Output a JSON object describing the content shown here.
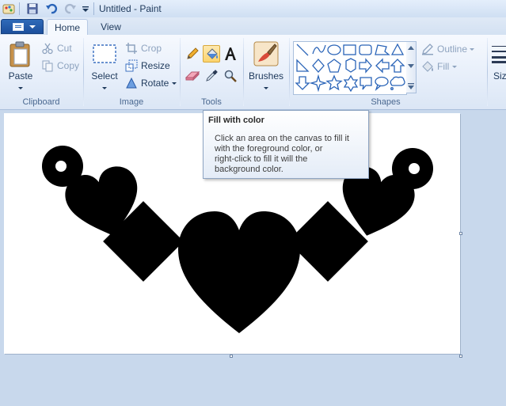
{
  "window": {
    "title": "Untitled - Paint"
  },
  "quick_access": {
    "icons": [
      "paint-app-icon",
      "save-icon",
      "undo-icon",
      "redo-icon",
      "customize-dropdown-icon"
    ]
  },
  "tabs": [
    {
      "label": "Home",
      "active": true
    },
    {
      "label": "View",
      "active": false
    }
  ],
  "ribbon": {
    "clipboard": {
      "group_label": "Clipboard",
      "paste_label": "Paste",
      "cut_label": "Cut",
      "copy_label": "Copy"
    },
    "image": {
      "group_label": "Image",
      "select_label": "Select",
      "crop_label": "Crop",
      "resize_label": "Resize",
      "rotate_label": "Rotate"
    },
    "tools": {
      "group_label": "Tools",
      "items": [
        "pencil",
        "fill-with-color",
        "text",
        "eraser",
        "color-picker",
        "magnifier"
      ],
      "selected": "fill-with-color"
    },
    "brushes": {
      "label": "Brushes"
    },
    "shapes": {
      "group_label": "Shapes",
      "outline_label": "Outline",
      "fill_label": "Fill"
    },
    "size": {
      "label": "Siz"
    }
  },
  "tooltip": {
    "title": "Fill with color",
    "body_lines": [
      "Click an area on the canvas to fill it",
      "with the foreground color, or",
      "right-click to fill it will the",
      "background color."
    ]
  },
  "colors": {
    "accent": "#1b4f9d",
    "ink": "#000000",
    "canvas": "#ffffff",
    "workspace": "#c8d8ec",
    "selected_tool": "#fbd36d"
  }
}
